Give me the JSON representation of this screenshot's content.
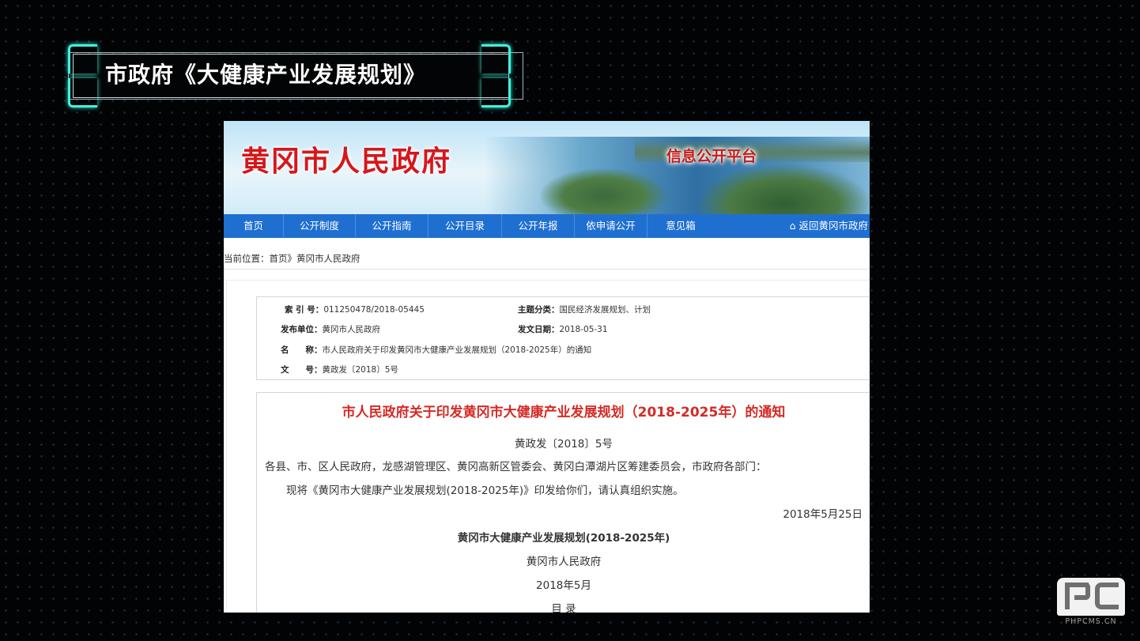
{
  "slide": {
    "title": "市政府《大健康产业发展规划》"
  },
  "site": {
    "name": "黄冈市人民政府",
    "platform": "信息公开平台",
    "nav": [
      "首页",
      "公开制度",
      "公开指南",
      "公开目录",
      "公开年报",
      "依申请公开",
      "意见箱"
    ],
    "back": "返回黄冈市政府",
    "breadcrumb": "当前位置：首页》黄冈市人民政府"
  },
  "meta": {
    "index_label": "索 引 号：",
    "index_value": "011250478/2018-05445",
    "category_label": "主题分类：",
    "category_value": "国民经济发展规划、计划",
    "publisher_label": "发布单位：",
    "publisher_value": "黄冈市人民政府",
    "date_label": "发文日期：",
    "date_value": "2018-05-31",
    "name_label": "名　　称：",
    "name_value": "市人民政府关于印发黄冈市大健康产业发展规划（2018-2025年）的通知",
    "doc_no_label": "文　　号：",
    "doc_no_value": "黄政发〔2018〕5号"
  },
  "document": {
    "title": "市人民政府关于印发黄冈市大健康产业发展规划（2018-2025年）的通知",
    "number": "黄政发〔2018〕5号",
    "addressees": "各县、市、区人民政府，龙感湖管理区、黄冈高新区管委会、黄冈白潭湖片区筹建委员会，市政府各部门：",
    "body": "现将《黄冈市大健康产业发展规划(2018-2025年)》印发给你们，请认真组织实施。",
    "sign_date": "2018年5月25日",
    "plan_title": "黄冈市大健康产业发展规划(2018-2025年)",
    "plan_org": "黄冈市人民政府",
    "plan_date": "2018年5月",
    "toc": "目 录"
  },
  "logo": {
    "text": "PHPCMS.CN",
    "mark": "PC"
  },
  "colors": {
    "accent_cyan": "#3ff2dd",
    "site_red": "#d6171b",
    "nav_blue": "#1f6fd1"
  }
}
